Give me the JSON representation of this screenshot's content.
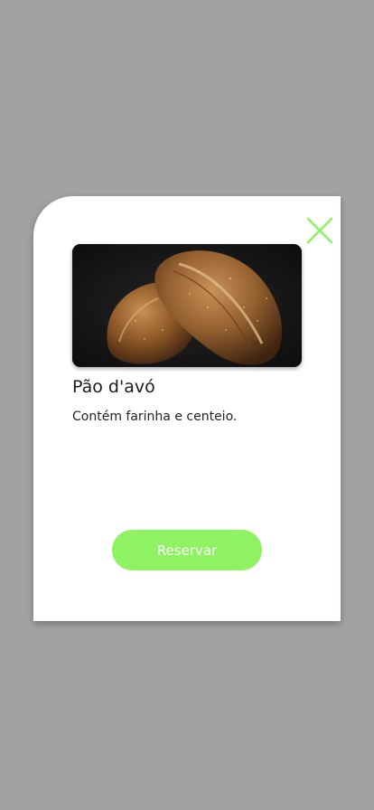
{
  "modal": {
    "close_icon": "close-icon",
    "accent_color": "#8ef262",
    "image_icon": "bread-loaves-photo",
    "title": "Pão d'avó",
    "description": "Contém farinha e centeio.",
    "reserve_label": "Reservar"
  }
}
